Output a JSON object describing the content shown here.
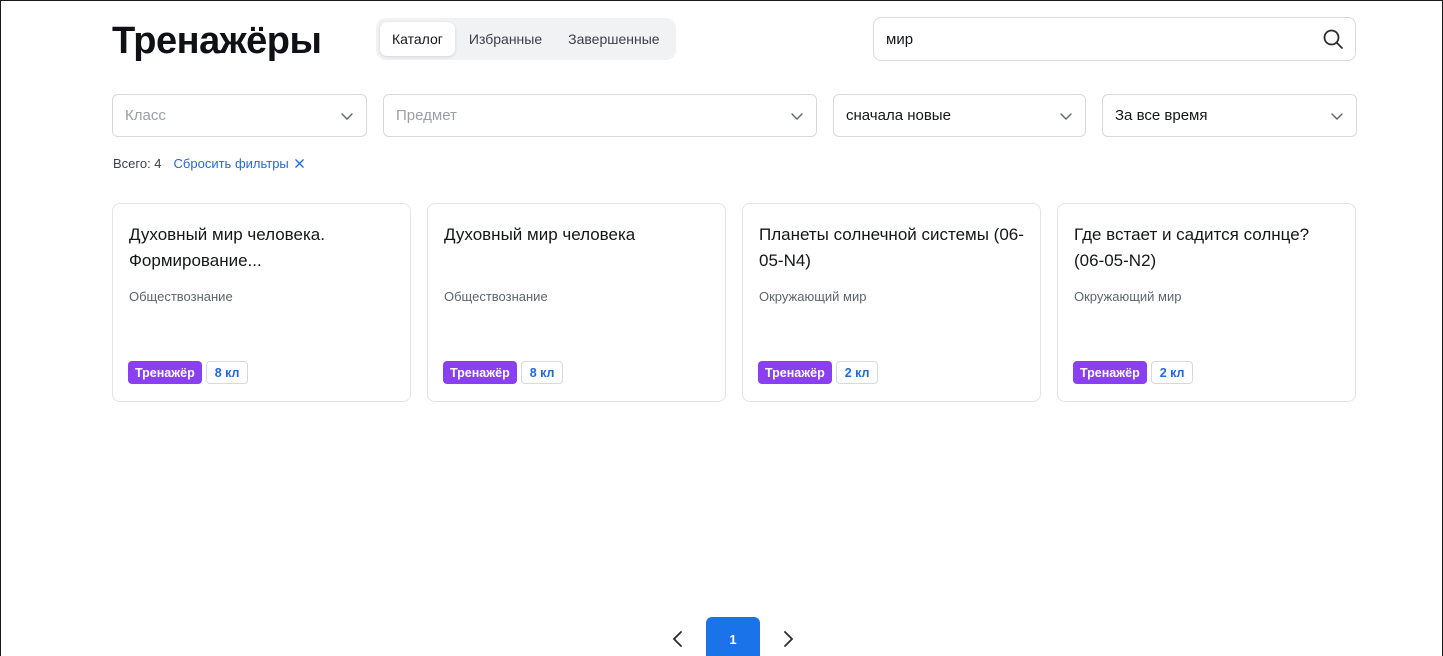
{
  "header": {
    "title": "Тренажёры",
    "tabs": [
      {
        "label": "Каталог",
        "active": true
      },
      {
        "label": "Избранные",
        "active": false
      },
      {
        "label": "Завершенные",
        "active": false
      }
    ]
  },
  "search": {
    "value": "мир",
    "icon": "search-icon"
  },
  "filters": {
    "grade": {
      "placeholder": "Класс"
    },
    "subject": {
      "placeholder": "Предмет"
    },
    "sort": {
      "value": "сначала новые"
    },
    "period": {
      "value": "За все время"
    }
  },
  "summary": {
    "total": "Всего: 4",
    "reset": "Сбросить фильтры"
  },
  "cards": [
    {
      "title": "Духовный мир человека. Формирование...",
      "subject": "Обществознание",
      "type": "Тренажёр",
      "grade": "8 кл"
    },
    {
      "title": "Духовный мир человека",
      "subject": "Обществознание",
      "type": "Тренажёр",
      "grade": "8 кл"
    },
    {
      "title": "Планеты солнечной системы (06-05-N4)",
      "subject": "Окружающий мир",
      "type": "Тренажёр",
      "grade": "2 кл"
    },
    {
      "title": "Где встает и садится солнце? (06-05-N2)",
      "subject": "Окружающий мир",
      "type": "Тренажёр",
      "grade": "2 кл"
    }
  ],
  "pagination": {
    "current": "1"
  },
  "colors": {
    "accent": "#1a73e8",
    "badge_purple": "#8a3ff0",
    "link_blue": "#1f6ad6"
  }
}
